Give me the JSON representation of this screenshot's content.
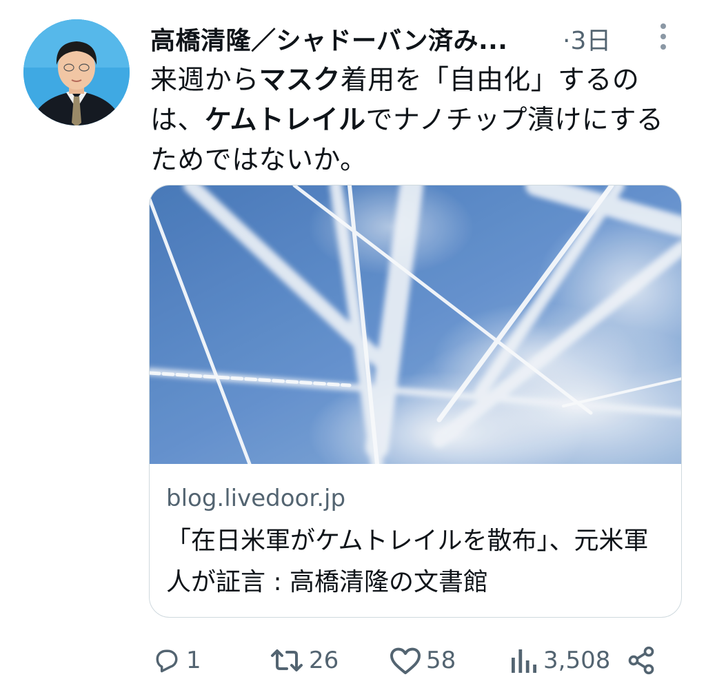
{
  "author": {
    "name": "高橋清隆／シャドーバン済み...",
    "separator": "·",
    "time": "3日"
  },
  "tweet": {
    "part1": "来週から",
    "bold1": "マスク",
    "part2": "着用を「自由化」するのは、",
    "bold2": "ケムトレイル",
    "part3": "でナノチップ漬けにするためではないか。"
  },
  "card": {
    "domain": "blog.livedoor.jp",
    "title": "「在日米軍がケムトレイルを散布」、元米軍人が証言 : 高橋清隆の文書館"
  },
  "actions": {
    "reply_count": "1",
    "retweet_count": "26",
    "like_count": "58",
    "views_count": "3,508"
  },
  "icons": {
    "reply": "reply-icon",
    "retweet": "retweet-icon",
    "like": "heart-icon",
    "views": "views-icon",
    "share": "share-icon",
    "more": "more-vertical-icon"
  },
  "colors": {
    "text": "#0f1419",
    "secondary": "#536471",
    "border": "#cfd9de",
    "sky": "#4f86c6"
  }
}
